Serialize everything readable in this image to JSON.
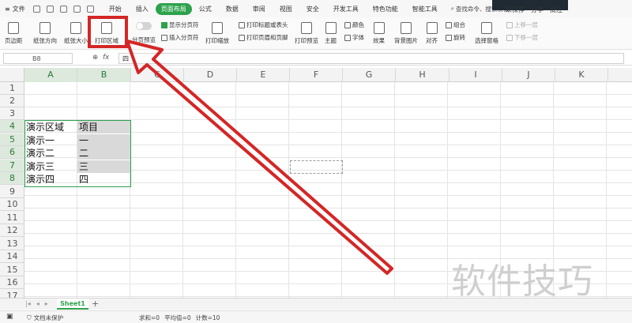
{
  "menubar": {
    "file_label": "文件",
    "tabs": [
      {
        "label": "开始"
      },
      {
        "label": "插入"
      },
      {
        "label": "页面布局",
        "active": true
      },
      {
        "label": "公式"
      },
      {
        "label": "数据"
      },
      {
        "label": "审阅"
      },
      {
        "label": "视图"
      },
      {
        "label": "安全"
      },
      {
        "label": "开发工具"
      },
      {
        "label": "特色功能"
      },
      {
        "label": "智能工具"
      }
    ],
    "search_label": "查找命令、搜索模板",
    "unsaved_label": "未保存",
    "share_label": "分享",
    "comment_label": "批注"
  },
  "toolbar": {
    "margins": "页边距",
    "orientation": "纸张方向",
    "paper_size": "纸张大小",
    "print_area": "打印区域",
    "page_break_preview": "分页预览",
    "show_page_breaks": "显示分页符",
    "insert_page_break": "插入分页符",
    "print_scaling": "打印缩放",
    "print_titles": "打印标题或表头",
    "print_header_footer": "打印页眉和页脚",
    "print_preview": "打印预览",
    "theme": "主题",
    "colors": "颜色",
    "fonts": "字体",
    "effects": "效果",
    "background": "背景图片",
    "align": "对齐",
    "group": "组合",
    "rotate": "旋转",
    "selection_pane": "选择窗格",
    "bring_forward": "上移一层",
    "send_backward": "下移一层"
  },
  "formula_bar": {
    "name_box": "B8",
    "fx_label": "fx",
    "content": "四"
  },
  "grid": {
    "columns": [
      "A",
      "B",
      "C",
      "D",
      "E",
      "F",
      "G",
      "H",
      "I",
      "J",
      "K"
    ],
    "rows": [
      "1",
      "2",
      "3",
      "4",
      "5",
      "6",
      "7",
      "8",
      "9",
      "10",
      "11",
      "12",
      "13",
      "14",
      "15",
      "16",
      "17"
    ],
    "cells": {
      "A4": "演示区域",
      "B4": "项目",
      "A5": "演示一",
      "B5": "一",
      "A6": "演示二",
      "B6": "二",
      "A7": "演示三",
      "B7": "三",
      "A8": "演示四",
      "B8": "四"
    }
  },
  "sheets": {
    "active": "Sheet1",
    "add_label": "+"
  },
  "statusbar": {
    "protect_label": "文档未保护",
    "sum": "求和=0",
    "average": "平均值=0",
    "count": "计数=10"
  },
  "watermark": "软件技巧",
  "colors": {
    "accent_green": "#2ca24c",
    "annotation_red": "#d42626",
    "highlight_gray": "#d9d9d9"
  }
}
